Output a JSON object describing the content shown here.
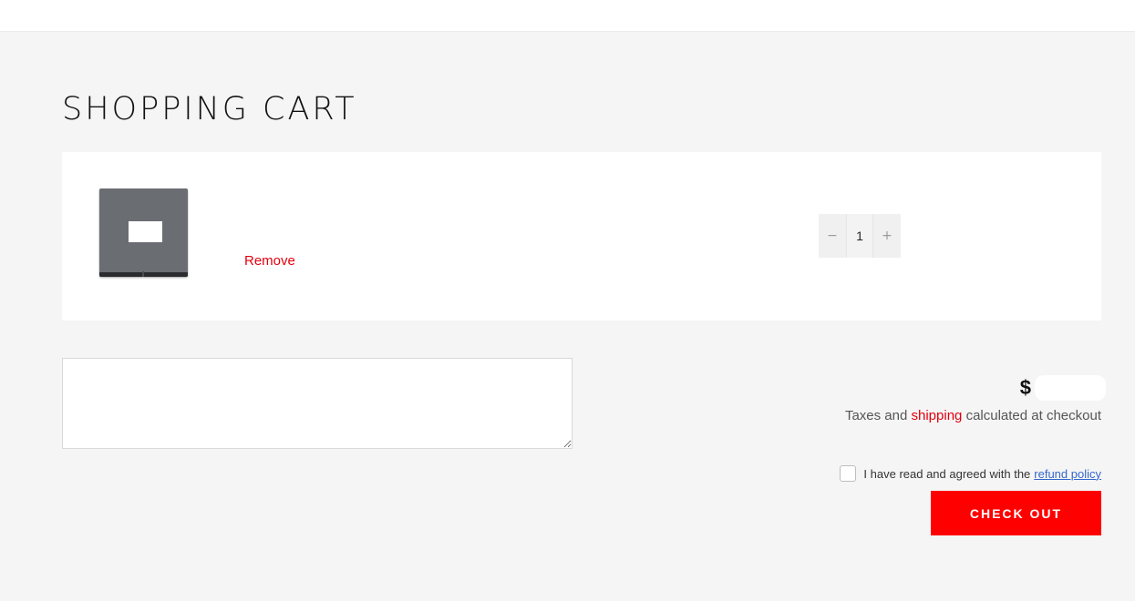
{
  "page": {
    "title": "SHOPPING CART"
  },
  "cart": {
    "items": [
      {
        "remove_label": "Remove",
        "quantity": "1",
        "decrement_symbol": "−",
        "increment_symbol": "+"
      }
    ]
  },
  "note": {
    "placeholder": ""
  },
  "summary": {
    "currency_symbol": "$",
    "tax_prefix": "Taxes and",
    "tax_link": "shipping",
    "tax_suffix": "calculated at checkout",
    "agree_text": "I have read and agreed with the",
    "agree_link": "refund policy",
    "checkout_label": "CHECK OUT"
  },
  "colors": {
    "accent": "#ff0000",
    "link_red": "#e3000e",
    "link_blue": "#3366cc",
    "background": "#f5f5f5"
  }
}
